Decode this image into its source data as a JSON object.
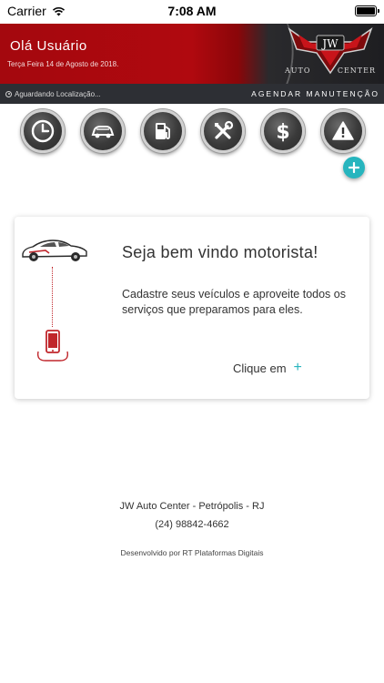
{
  "status_bar": {
    "carrier": "Carrier",
    "time": "7:08 AM",
    "icons": [
      "wifi-icon",
      "battery-icon"
    ]
  },
  "header": {
    "greeting": "Olá Usuário",
    "date": "Terça Feira 14 de Agosto de 2018.",
    "logo": {
      "monogram": "JW",
      "word1": "AUTO",
      "word2": "CENTER"
    }
  },
  "location_bar": {
    "status": "Aguardando Localização...",
    "action": "AGENDAR MANUTENÇÃO"
  },
  "shortcuts": [
    {
      "icon": "clock-icon"
    },
    {
      "icon": "car-icon"
    },
    {
      "icon": "fuel-pump-icon"
    },
    {
      "icon": "tools-icon"
    },
    {
      "icon": "dollar-icon"
    },
    {
      "icon": "warning-icon"
    }
  ],
  "add_button": {
    "icon": "plus-icon"
  },
  "welcome_card": {
    "title": "Seja bem vindo motorista!",
    "text": "Cadastre seus veículos e aproveite todos os serviços que preparamos para eles.",
    "cta_label": "Clique em",
    "cta_symbol": "+"
  },
  "footer": {
    "line1": "JW Auto Center - Petrópolis - RJ",
    "phone": "(24) 98842-4662",
    "credits": "Desenvolvido por RT Plataformas Digitais"
  },
  "colors": {
    "header_red": "#a4080e",
    "dark_bar": "#2d2f34",
    "accent_teal": "#27b5be"
  }
}
